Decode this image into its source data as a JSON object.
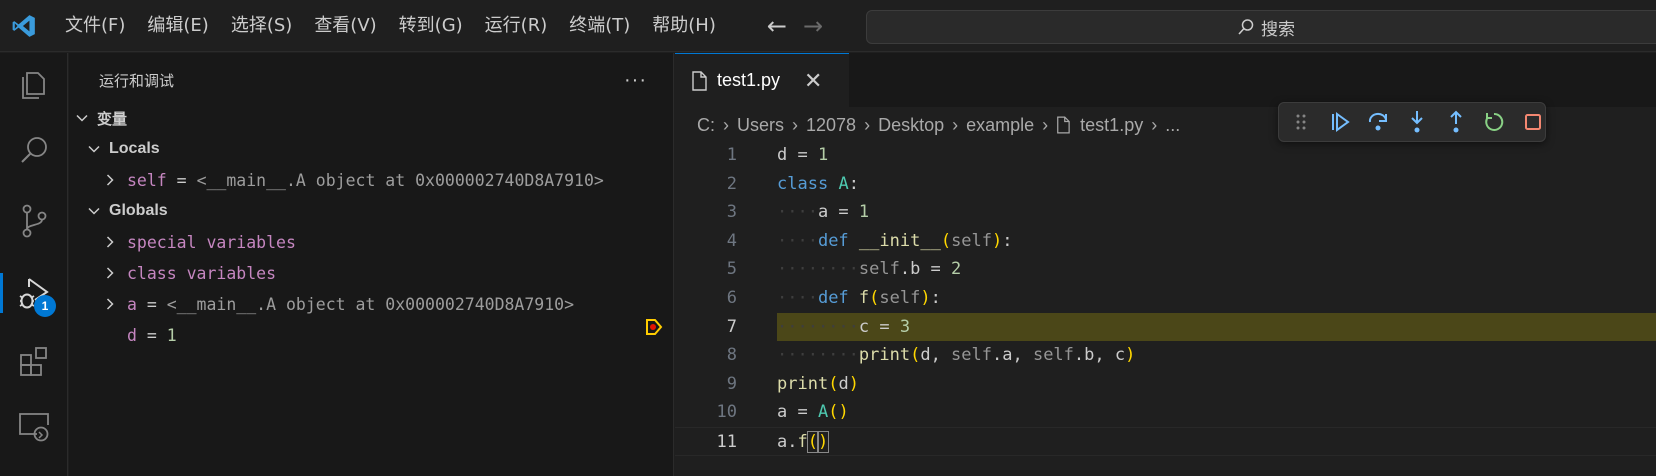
{
  "menu": [
    "文件(F)",
    "编辑(E)",
    "选择(S)",
    "查看(V)",
    "转到(G)",
    "运行(R)",
    "终端(T)",
    "帮助(H)"
  ],
  "search": {
    "label": "搜索"
  },
  "activity": {
    "debug_badge": "1"
  },
  "sidebar": {
    "title": "运行和调试",
    "more": "···",
    "variables_title": "变量",
    "locals_label": "Locals",
    "globals_label": "Globals",
    "locals": [
      {
        "name": "self",
        "op": " = ",
        "value": "<__main__.A object at 0x000002740D8A7910>"
      }
    ],
    "globals": [
      {
        "label": "special variables"
      },
      {
        "label": "class variables"
      },
      {
        "name": "a",
        "op": " = ",
        "value": "<__main__.A object at 0x000002740D8A7910>"
      },
      {
        "name": "d",
        "op": " = ",
        "value": "1"
      }
    ]
  },
  "editor": {
    "tab_label": "test1.py",
    "breadcrumb": [
      "C:",
      "Users",
      "12078",
      "Desktop",
      "example",
      "test1.py",
      "..."
    ],
    "current_line": 7,
    "line_numbers": [
      "1",
      "2",
      "3",
      "4",
      "5",
      "6",
      "7",
      "8",
      "9",
      "10",
      "11"
    ]
  },
  "colors": {
    "accent": "#0078d4",
    "current_line_bg": "#4b4718",
    "debug_continue": "#75beff",
    "debug_restart": "#89d185",
    "debug_stop": "#f48771",
    "breakpoint_arrow": "#ffcc00"
  }
}
